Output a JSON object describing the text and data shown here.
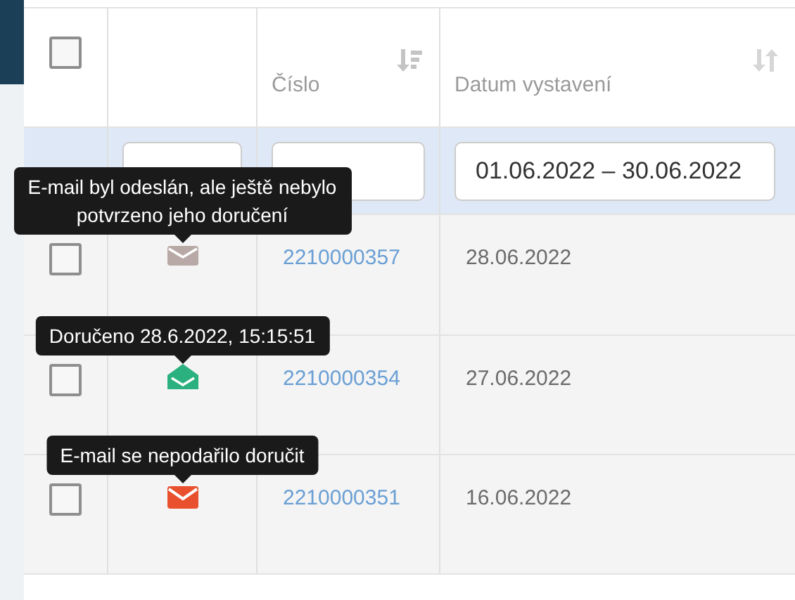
{
  "table": {
    "select_all": {
      "checked": false
    },
    "columns": [
      {
        "label": "Číslo",
        "sorted": true
      },
      {
        "label": "Datum vystavení",
        "sorted": false
      }
    ],
    "filters": {
      "date_range": {
        "value": "01.06.2022 – 30.06.2022"
      }
    },
    "rows": [
      {
        "checked": false,
        "status": {
          "kind": "sent",
          "color": "#b9a9a6",
          "tooltip": "E-mail byl odeslán, ale ještě nebylo potvrzeno jeho doručení"
        },
        "number": "2210000357",
        "date": "28.06.2022"
      },
      {
        "checked": false,
        "status": {
          "kind": "delivered",
          "color": "#2bb07f",
          "tooltip": "Doručeno 28.6.2022, 15:15:51"
        },
        "number": "2210000354",
        "date": "27.06.2022"
      },
      {
        "checked": false,
        "status": {
          "kind": "failed",
          "color": "#e8502e",
          "tooltip": "E-mail se nepodařilo doručit"
        },
        "number": "2210000351",
        "date": "16.06.2022"
      }
    ]
  }
}
